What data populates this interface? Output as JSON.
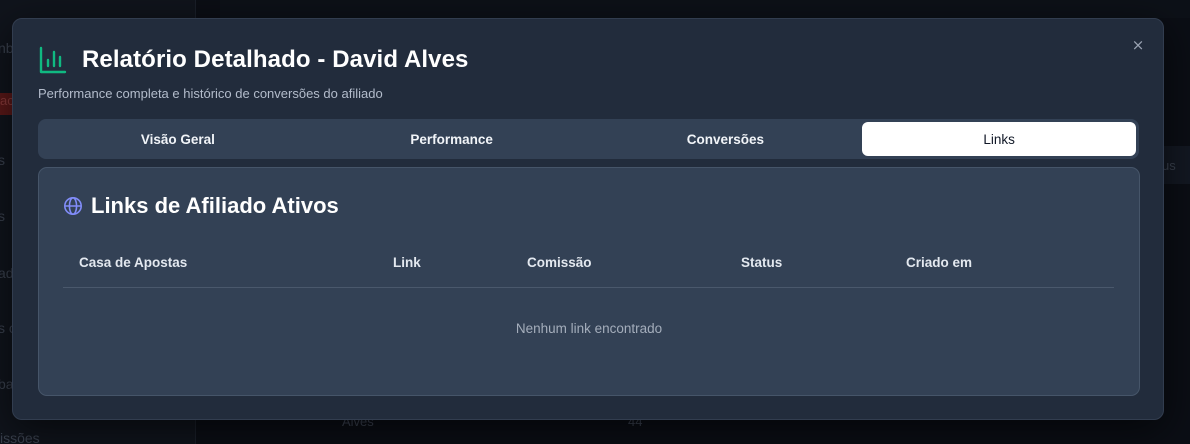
{
  "background": {
    "sidebar_fragments": [
      "nb",
      "ac",
      "s",
      "s",
      "ad",
      "s c",
      "ba",
      "issões"
    ],
    "right_fragment": "us",
    "row_name": "Alves",
    "row_value": "44"
  },
  "modal": {
    "title": "Relatório Detalhado - David Alves",
    "subtitle": "Performance completa e histórico de conversões do afiliado",
    "close_label": "×",
    "title_icon": "bar-chart-icon",
    "accent_color": "#10b981"
  },
  "tabs": [
    {
      "label": "Visão Geral",
      "active": false
    },
    {
      "label": "Performance",
      "active": false
    },
    {
      "label": "Conversões",
      "active": false
    },
    {
      "label": "Links",
      "active": true
    }
  ],
  "links_card": {
    "title": "Links de Afiliado Ativos",
    "icon": "globe-icon",
    "icon_color": "#818cf8",
    "columns": [
      "Casa de Apostas",
      "Link",
      "Comissão",
      "Status",
      "Criado em"
    ],
    "rows": [],
    "empty_message": "Nenhum link encontrado"
  }
}
